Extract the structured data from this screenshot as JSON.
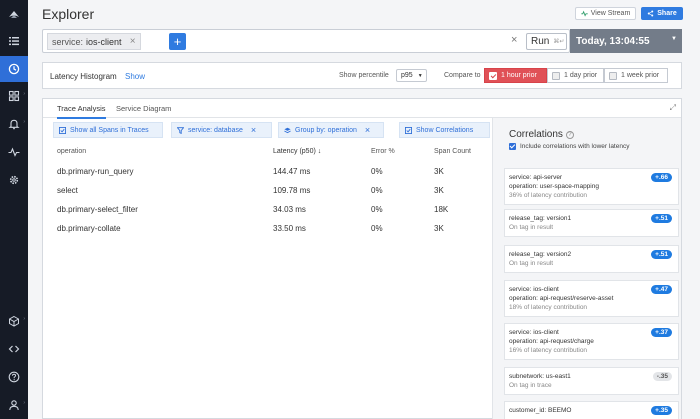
{
  "app": {
    "title": "Explorer"
  },
  "header": {
    "view_stream": "View Stream",
    "share": "Share"
  },
  "query": {
    "chip_label": "service:",
    "chip_value": "ios-client",
    "run": "Run",
    "run_mini": "⌘↵",
    "time": "Today, 13:04:55"
  },
  "histogram": {
    "title": "Latency Histogram",
    "show": "Show",
    "percentile_label": "Show percentile",
    "percentile_value": "p95",
    "compare_label": "Compare to",
    "compare_options": [
      {
        "label": "1 hour prior",
        "checked": true
      },
      {
        "label": "1 day prior",
        "checked": false
      },
      {
        "label": "1 week prior",
        "checked": false
      }
    ]
  },
  "tabs": [
    "Trace Analysis",
    "Service Diagram"
  ],
  "filters": {
    "show_all": "Show all Spans in Traces",
    "service": "service: database",
    "group_by": "Group by: operation",
    "show_corr": "Show Correlations"
  },
  "table": {
    "headers": {
      "operation": "operation",
      "latency": "Latency (p50)",
      "error": "Error %",
      "count": "Span Count"
    },
    "rows": [
      {
        "operation": "db.primary-run_query",
        "latency": "144.47 ms",
        "error": "0%",
        "count": "3K"
      },
      {
        "operation": "select",
        "latency": "109.78 ms",
        "error": "0%",
        "count": "3K"
      },
      {
        "operation": "db.primary-select_filter",
        "latency": "34.03 ms",
        "error": "0%",
        "count": "18K"
      },
      {
        "operation": "db.primary-collate",
        "latency": "33.50 ms",
        "error": "0%",
        "count": "3K"
      }
    ]
  },
  "correlations": {
    "title": "Correlations",
    "include_label": "Include correlations with lower latency",
    "cards": [
      {
        "line1": "service: api-server",
        "line2": "operation: user-space-mapping",
        "sub": "36% of latency contribution",
        "score": "+.66",
        "grey": false
      },
      {
        "line1": "release_tag: version1",
        "line2": "",
        "sub": "On tag in result",
        "score": "+.51",
        "grey": false
      },
      {
        "line1": "release_tag: version2",
        "line2": "",
        "sub": "On tag in result",
        "score": "+.51",
        "grey": false
      },
      {
        "line1": "service: ios-client",
        "line2": "operation: api-request/reserve-asset",
        "sub": "18% of latency contribution",
        "score": "+.47",
        "grey": false
      },
      {
        "line1": "service: ios-client",
        "line2": "operation: api-request/charge",
        "sub": "16% of latency contribution",
        "score": "+.37",
        "grey": false
      },
      {
        "line1": "subnetwork: us-east1",
        "line2": "",
        "sub": "On tag in trace",
        "score": "-.35",
        "grey": true
      },
      {
        "line1": "customer_id: BEEMO",
        "line2": "",
        "sub": "",
        "score": "+.35",
        "grey": false
      }
    ]
  },
  "colors": {
    "accent": "#2f7be0",
    "sidebar": "#161b26",
    "compare_on": "#e05157"
  },
  "sidebar_icons": [
    "logo-icon",
    "list-icon",
    "clock-icon",
    "dashboard-icon",
    "bell-icon",
    "pulse-icon",
    "gear-icon",
    "cube-icon",
    "code-icon",
    "help-icon",
    "user-icon"
  ]
}
